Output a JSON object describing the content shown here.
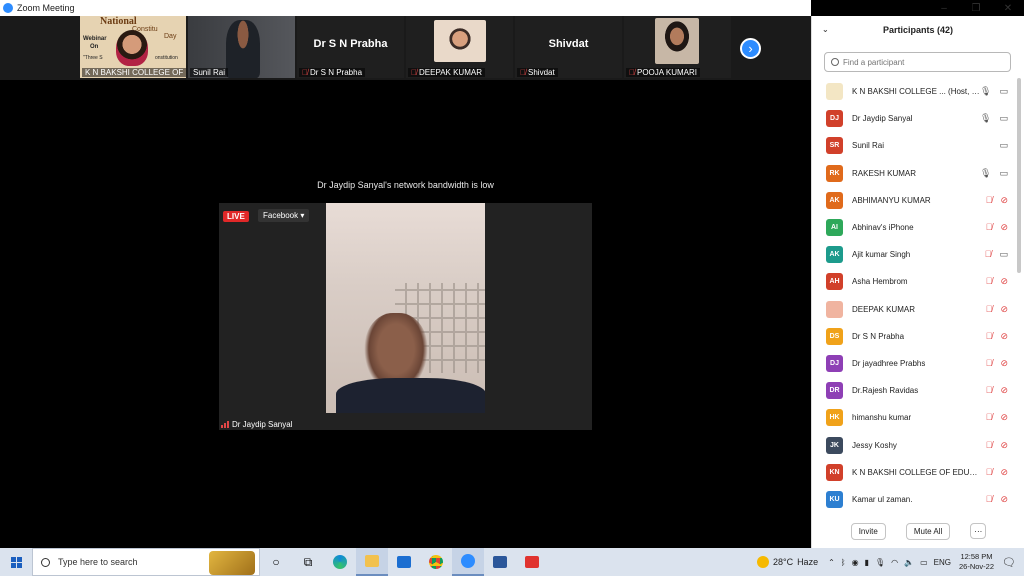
{
  "window": {
    "title": "Zoom Meeting"
  },
  "window_controls": {
    "minimize": "–",
    "restore": "❐",
    "close": "✕"
  },
  "gallery": [
    {
      "name": "K N BAKSHI COLLEGE OF ...",
      "muted": false,
      "type": "video",
      "poster_lines": [
        "National",
        "Constitu",
        "Day",
        "Webinar",
        "On",
        "\"Three S",
        "onstitution"
      ]
    },
    {
      "name": "Sunil Rai",
      "muted": false,
      "type": "video"
    },
    {
      "name": "Dr S N Prabha",
      "muted": true,
      "type": "text",
      "label": "Dr S N Prabha"
    },
    {
      "name": "DEEPAK KUMAR",
      "muted": true,
      "type": "photo"
    },
    {
      "name": "Shivdat",
      "muted": true,
      "type": "text",
      "label": "Shivdat"
    },
    {
      "name": "POOJA KUMARI",
      "muted": true,
      "type": "photo"
    }
  ],
  "notice": "Dr Jaydip Sanyal's network bandwidth is low",
  "speaker": {
    "name": "Dr Jaydip Sanyal",
    "live_label": "LIVE",
    "stream_target": "Facebook"
  },
  "participants": {
    "title": "Participants (42)",
    "search_placeholder": "Find a participant",
    "items": [
      {
        "initials": "",
        "name": "K N BAKSHI COLLEGE ... (Host, me)",
        "color": "#f3e6c4",
        "mic": "on",
        "video": "on"
      },
      {
        "initials": "DJ",
        "name": "Dr Jaydip Sanyal",
        "color": "#d1402a",
        "mic": "on",
        "video": "on"
      },
      {
        "initials": "SR",
        "name": "Sunil Rai",
        "color": "#d1402a",
        "mic": "none",
        "video": "on"
      },
      {
        "initials": "RK",
        "name": "RAKESH KUMAR",
        "color": "#e06a1b",
        "mic": "on",
        "video": "on"
      },
      {
        "initials": "AK",
        "name": "ABHIMANYU KUMAR",
        "color": "#e06a1b",
        "mic": "off",
        "video": "off"
      },
      {
        "initials": "AI",
        "name": "Abhinav's iPhone",
        "color": "#2ea85a",
        "mic": "off",
        "video": "off"
      },
      {
        "initials": "AK",
        "name": "Ajit kumar Singh",
        "color": "#1d9b8c",
        "mic": "off",
        "video": "on"
      },
      {
        "initials": "AH",
        "name": "Asha Hembrom",
        "color": "#d1402a",
        "mic": "off",
        "video": "off"
      },
      {
        "initials": "",
        "name": "DEEPAK KUMAR",
        "color": "#f0b4a0",
        "mic": "off",
        "video": "off"
      },
      {
        "initials": "DS",
        "name": "Dr S N Prabha",
        "color": "#f0a21a",
        "mic": "off",
        "video": "off"
      },
      {
        "initials": "DJ",
        "name": "Dr jayadhree Prabhs",
        "color": "#8e3fb5",
        "mic": "off",
        "video": "off"
      },
      {
        "initials": "DR",
        "name": "Dr.Rajesh Ravidas",
        "color": "#8e3fb5",
        "mic": "off",
        "video": "off"
      },
      {
        "initials": "HK",
        "name": "himanshu kumar",
        "color": "#f0a21a",
        "mic": "off",
        "video": "off"
      },
      {
        "initials": "JK",
        "name": "Jessy Koshy",
        "color": "#3c4a5e",
        "mic": "off",
        "video": "off"
      },
      {
        "initials": "KN",
        "name": "K N BAKSHI COLLEGE OF EDUCA...",
        "color": "#d1402a",
        "mic": "off",
        "video": "off"
      },
      {
        "initials": "KU",
        "name": "Kamar ul zaman.",
        "color": "#2d7fd1",
        "mic": "off",
        "video": "off"
      }
    ],
    "invite_label": "Invite",
    "mute_all_label": "Mute All",
    "more_label": "···"
  },
  "taskbar": {
    "search_placeholder": "Type here to search",
    "temperature": "28°C",
    "weather": "Haze",
    "language": "ENG",
    "time": "12:58 PM",
    "date": "26-Nov-22"
  }
}
